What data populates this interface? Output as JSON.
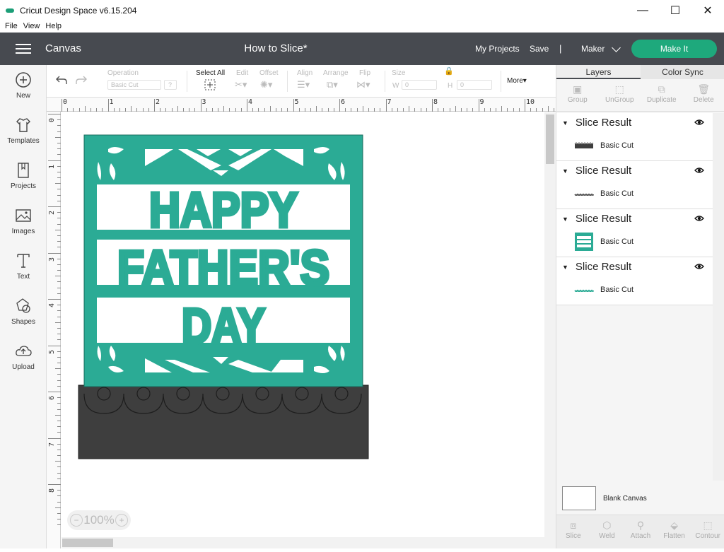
{
  "window": {
    "title": "Cricut Design Space  v6.15.204",
    "minimize": "—",
    "maximize": "☐",
    "close": "✕"
  },
  "menu": [
    "File",
    "View",
    "Help"
  ],
  "header": {
    "section": "Canvas",
    "project_title": "How to Slice*",
    "my_projects": "My Projects",
    "save": "Save",
    "separator": "|",
    "machine": "Maker",
    "make_it": "Make It",
    "accent": "#1ea97c",
    "bar_color": "#474a50"
  },
  "sidebar": [
    {
      "label": "New",
      "icon": "plus-circle-icon"
    },
    {
      "label": "Templates",
      "icon": "shirt-icon"
    },
    {
      "label": "Projects",
      "icon": "bookmark-icon"
    },
    {
      "label": "Images",
      "icon": "image-icon"
    },
    {
      "label": "Text",
      "icon": "text-icon"
    },
    {
      "label": "Shapes",
      "icon": "shapes-icon"
    },
    {
      "label": "Upload",
      "icon": "cloud-upload-icon"
    }
  ],
  "toolbar": {
    "operation_label": "Operation",
    "operation_value": "Basic Cut",
    "select_all": "Select All",
    "edit": "Edit",
    "offset": "Offset",
    "align": "Align",
    "arrange": "Arrange",
    "flip": "Flip",
    "size": "Size",
    "w_label": "W",
    "w_value": "0",
    "h_label": "H",
    "h_value": "0",
    "more": "More"
  },
  "ruler": {
    "top": [
      "0",
      "1",
      "2",
      "3",
      "4",
      "5",
      "6",
      "7",
      "8",
      "9",
      "10"
    ],
    "left": [
      "0",
      "1",
      "2",
      "3",
      "4",
      "5",
      "6",
      "7",
      "8"
    ]
  },
  "design": {
    "line1": "HAPPY",
    "line2": "FATHER'S",
    "line3": "DAY",
    "card_color": "#2bab95",
    "base_color": "#3e3e3e"
  },
  "zoom": {
    "minus": "−",
    "value": "100%",
    "plus": "+"
  },
  "panel": {
    "tabs": [
      "Layers",
      "Color Sync"
    ],
    "actions": [
      {
        "label": "Group",
        "icon": "group-icon"
      },
      {
        "label": "UnGroup",
        "icon": "ungroup-icon"
      },
      {
        "label": "Duplicate",
        "icon": "duplicate-icon"
      },
      {
        "label": "Delete",
        "icon": "trash-icon"
      }
    ],
    "layers": [
      {
        "title": "Slice Result",
        "sub": "Basic Cut",
        "thumb": "dark-strip"
      },
      {
        "title": "Slice Result",
        "sub": "Basic Cut",
        "thumb": "scallop-strip"
      },
      {
        "title": "Slice Result",
        "sub": "Basic Cut",
        "thumb": "teal-card"
      },
      {
        "title": "Slice Result",
        "sub": "Basic Cut",
        "thumb": "teal-strip"
      }
    ],
    "blank_canvas": "Blank Canvas",
    "bottom": [
      {
        "label": "Slice",
        "icon": "slice-icon"
      },
      {
        "label": "Weld",
        "icon": "weld-icon"
      },
      {
        "label": "Attach",
        "icon": "attach-icon"
      },
      {
        "label": "Flatten",
        "icon": "flatten-icon"
      },
      {
        "label": "Contour",
        "icon": "contour-icon"
      }
    ]
  }
}
